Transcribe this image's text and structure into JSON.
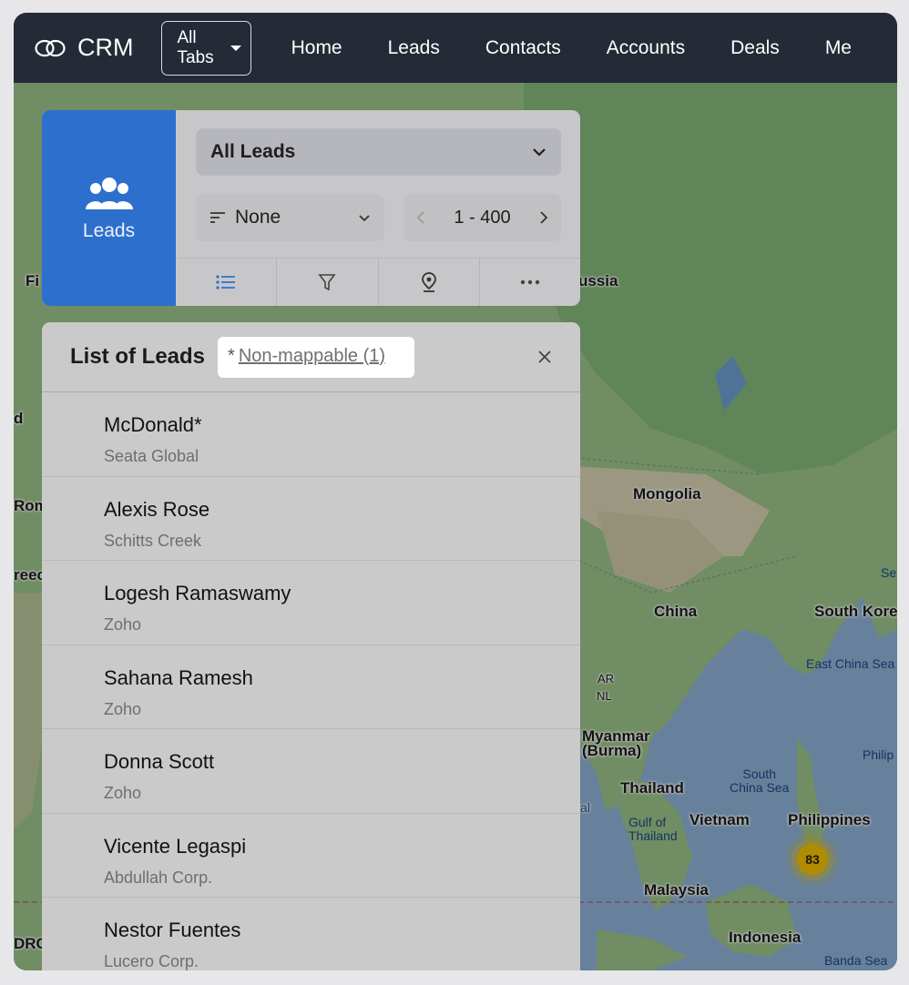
{
  "nav": {
    "brand": "CRM",
    "all_tabs": "All Tabs",
    "links": [
      "Home",
      "Leads",
      "Contacts",
      "Accounts",
      "Deals",
      "Me"
    ]
  },
  "module": {
    "label": "Leads",
    "icon": "users-icon"
  },
  "controls": {
    "view": "All Leads",
    "sort": "None",
    "range": "1 - 400",
    "tools": [
      "list-icon",
      "filter-icon",
      "location-pin-icon",
      "more-icon"
    ]
  },
  "list": {
    "title": "List of Leads",
    "nonmap_prefix": "*",
    "nonmap_link": "Non-mappable (1)",
    "rows": [
      {
        "name": "McDonald*",
        "company": "Seata Global"
      },
      {
        "name": "Alexis Rose",
        "company": "Schitts Creek"
      },
      {
        "name": "Logesh Ramaswamy",
        "company": "Zoho"
      },
      {
        "name": "Sahana Ramesh",
        "company": "Zoho"
      },
      {
        "name": "Donna Scott",
        "company": "Zoho"
      },
      {
        "name": "Vicente Legaspi",
        "company": "Abdullah Corp."
      },
      {
        "name": "Nestor Fuentes",
        "company": "Lucero Corp."
      }
    ]
  },
  "map": {
    "labels": {
      "russia": "ussia",
      "mongolia": "Mongolia",
      "china": "China",
      "south_korea": "South Kore",
      "myanmar": "Myanmar\n(Burma)",
      "thailand": "Thailand",
      "vietnam": "Vietnam",
      "philippines": "Philippines",
      "malaysia": "Malaysia",
      "indonesia": "Indonesia",
      "fi": "Fi",
      "d": "d",
      "rom": "Rom",
      "reec": "reec",
      "drc": "DRC",
      "ar": "AR",
      "nl": "NL",
      "al": "al"
    },
    "water": {
      "east_china_sea": "East China Sea",
      "south_china_sea": "South\nChina Sea",
      "gulf_thailand": "Gulf of\nThailand",
      "philip": "Philip",
      "banda": "Banda Sea",
      "se": "Se"
    },
    "cluster_count": "83",
    "cluster_color": "#f4c400"
  },
  "colors": {
    "topnav": "#242a36",
    "module": "#2d6fcc"
  }
}
